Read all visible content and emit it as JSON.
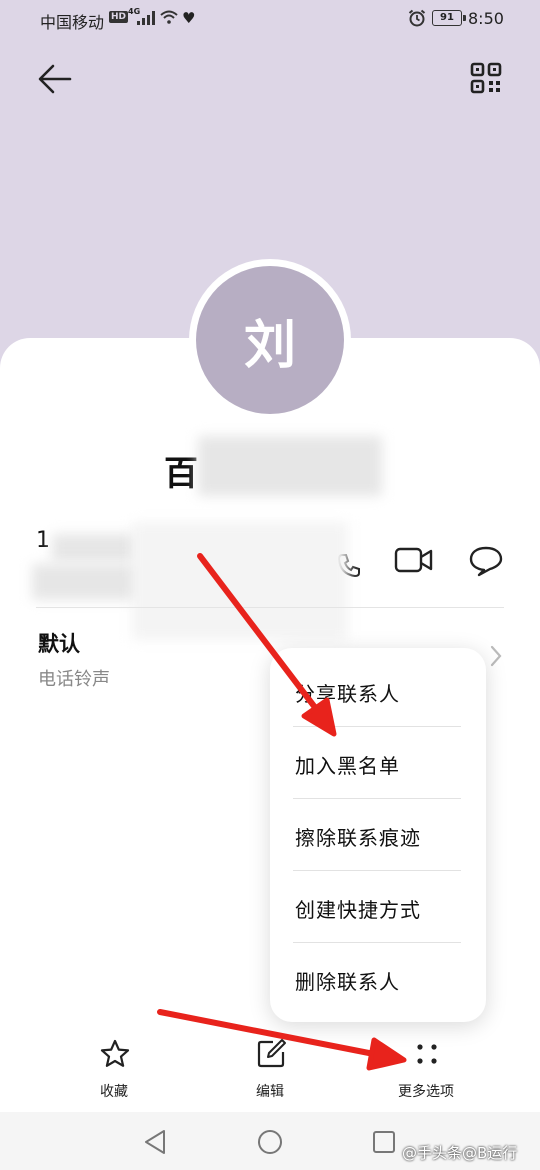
{
  "status_bar": {
    "carrier": "中国移动",
    "hd_badge": "HD",
    "network": "4G",
    "battery": "91",
    "time": "8:50"
  },
  "contact": {
    "avatar_initial": "刘",
    "name_visible": "百",
    "phone_visible": "1"
  },
  "ringtone": {
    "title": "默认",
    "subtitle": "电话铃声"
  },
  "popup_menu": {
    "items": [
      {
        "label": "分享联系人"
      },
      {
        "label": "加入黑名单"
      },
      {
        "label": "擦除联系痕迹"
      },
      {
        "label": "创建快捷方式"
      },
      {
        "label": "删除联系人"
      }
    ]
  },
  "toolbar": {
    "favorite_label": "收藏",
    "edit_label": "编辑",
    "more_label": "更多选项"
  },
  "watermark": "@手头条@B运行",
  "colors": {
    "header_bg": "#ddd6e6",
    "avatar_bg": "#b7aec3",
    "annotation_arrow": "#e8231c"
  }
}
